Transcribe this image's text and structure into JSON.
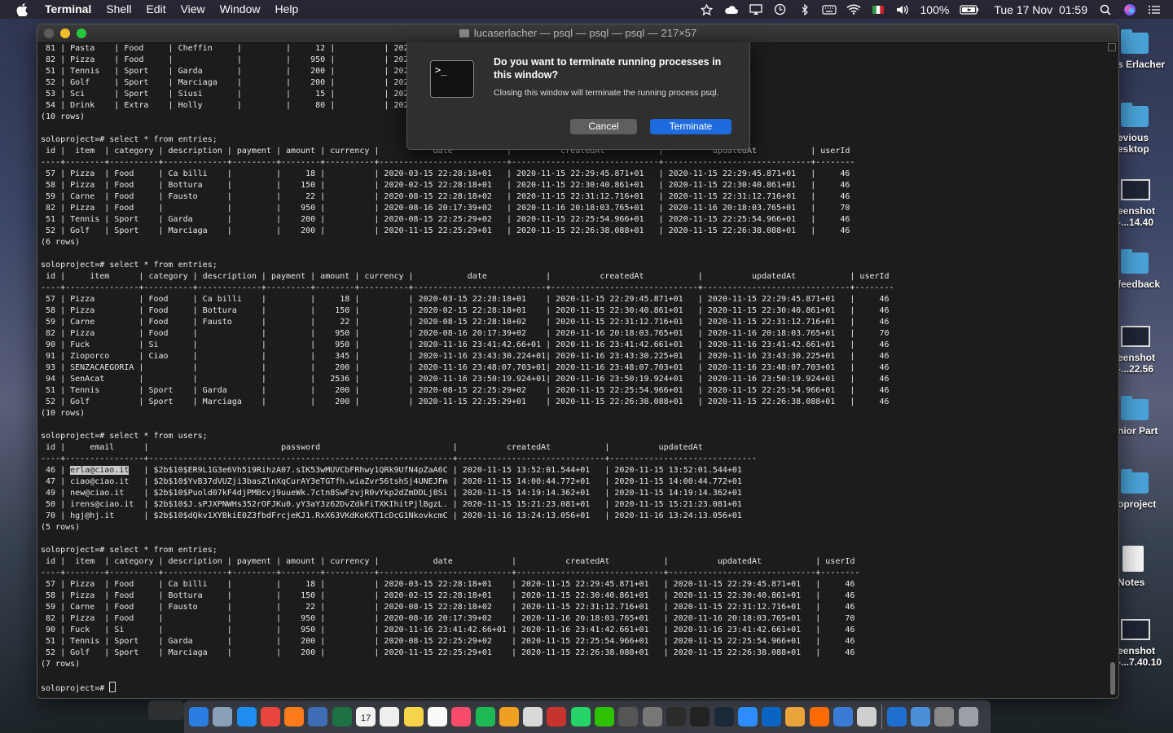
{
  "menubar": {
    "app": "Terminal",
    "items": [
      "Shell",
      "Edit",
      "View",
      "Window",
      "Help"
    ],
    "battery": "100%",
    "datetime": "Tue 17 Nov  01:59"
  },
  "window": {
    "title": "lucaserlacher — psql — psql — psql — 217×57"
  },
  "console_lines": [
    " 81 | Pasta    | Food     | Cheffin     |         |     12 |          | 2020-",
    " 82 | Pizza    | Food     |             |         |    950 |          | 2020-",
    " 51 | Tennis   | Sport    | Garda       |         |    200 |          | 2020-",
    " 52 | Golf     | Sport    | Marciaga    |         |    200 |          | 2020-",
    " 53 | Sci      | Sport    | Siusi       |         |     15 |          | 2020-",
    " 54 | Drink    | Extra    | Holly       |         |     80 |          | 2020-",
    "(10 rows)",
    "",
    "soloproject=# select * from entries;",
    " id |  item  | category | description | payment | amount | currency |           date           |          createdAt           |          updatedAt           | userId",
    "----+--------+----------+-------------+---------+--------+----------+--------------------------+------------------------------+------------------------------+--------",
    " 57 | Pizza  | Food     | Ca billi    |         |     18 |          | 2020-03-15 22:28:18+01   | 2020-11-15 22:29:45.871+01   | 2020-11-15 22:29:45.871+01   |     46",
    " 58 | Pizza  | Food     | Bottura     |         |    150 |          | 2020-02-15 22:28:18+01   | 2020-11-15 22:30:40.861+01   | 2020-11-15 22:30:40.861+01   |     46",
    " 59 | Carne  | Food     | Fausto      |         |     22 |          | 2020-08-15 22:28:18+02   | 2020-11-15 22:31:12.716+01   | 2020-11-15 22:31:12.716+01   |     46",
    " 82 | Pizza  | Food     |             |         |    950 |          | 2020-08-16 20:17:39+02   | 2020-11-16 20:18:03.765+01   | 2020-11-16 20:18:03.765+01   |     70",
    " 51 | Tennis | Sport    | Garda       |         |    200 |          | 2020-08-15 22:25:29+02   | 2020-11-15 22:25:54.966+01   | 2020-11-15 22:25:54.966+01   |     46",
    " 52 | Golf   | Sport    | Marciaga    |         |    200 |          | 2020-11-15 22:25:29+01   | 2020-11-15 22:26:38.088+01   | 2020-11-15 22:26:38.088+01   |     46",
    "(6 rows)",
    "",
    "soloproject=# select * from entries;",
    " id |     item      | category | description | payment | amount | currency |           date            |          createdAt           |          updatedAt           | userId",
    "----+---------------+----------+-------------+---------+--------+----------+---------------------------+------------------------------+------------------------------+--------",
    " 57 | Pizza         | Food     | Ca billi    |         |     18 |          | 2020-03-15 22:28:18+01    | 2020-11-15 22:29:45.871+01   | 2020-11-15 22:29:45.871+01   |     46",
    " 58 | Pizza         | Food     | Bottura     |         |    150 |          | 2020-02-15 22:28:18+01    | 2020-11-15 22:30:40.861+01   | 2020-11-15 22:30:40.861+01   |     46",
    " 59 | Carne         | Food     | Fausto      |         |     22 |          | 2020-08-15 22:28:18+02    | 2020-11-15 22:31:12.716+01   | 2020-11-15 22:31:12.716+01   |     46",
    " 82 | Pizza         | Food     |             |         |    950 |          | 2020-08-16 20:17:39+02    | 2020-11-16 20:18:03.765+01   | 2020-11-16 20:18:03.765+01   |     70",
    " 90 | Fuck          | Si       |             |         |    950 |          | 2020-11-16 23:41:42.66+01 | 2020-11-16 23:41:42.661+01   | 2020-11-16 23:41:42.661+01   |     46",
    " 91 | Zioporco      | Ciao     |             |         |    345 |          | 2020-11-16 23:43:30.224+01| 2020-11-16 23:43:30.225+01   | 2020-11-16 23:43:30.225+01   |     46",
    " 93 | SENZACAEGORIA |          |             |         |    200 |          | 2020-11-16 23:48:07.703+01| 2020-11-16 23:48:07.703+01   | 2020-11-16 23:48:07.703+01   |     46",
    " 94 | SenAcat       |          |             |         |   2536 |          | 2020-11-16 23:50:19.924+01| 2020-11-16 23:50:19.924+01   | 2020-11-16 23:50:19.924+01   |     46",
    " 51 | Tennis        | Sport    | Garda       |         |    200 |          | 2020-08-15 22:25:29+02    | 2020-11-15 22:25:54.966+01   | 2020-11-15 22:25:54.966+01   |     46",
    " 52 | Golf          | Sport    | Marciaga    |         |    200 |          | 2020-11-15 22:25:29+01    | 2020-11-15 22:26:38.088+01   | 2020-11-15 22:26:38.088+01   |     46",
    "(10 rows)",
    "",
    "soloproject=# select * from users;",
    " id |     email      |                           password                           |          createdAt           |          updatedAt",
    "----+----------------+--------------------------------------------------------------+------------------------------+------------------------------",
    " 46 | erla@ciao.it   | $2b$10$ER9L1G3e6Vh519RihzA07.sIK53wMUVCbFRhwy1QRk9UfN4pZaA6C | 2020-11-15 13:52:01.544+01   | 2020-11-15 13:52:01.544+01",
    " 47 | ciao@ciao.it   | $2b$10$YvB37dVUZji3basZlnXqCurAY3eTGTfh.wiaZvr56tshSj4UNEJFm | 2020-11-15 14:00:44.772+01   | 2020-11-15 14:00:44.772+01",
    " 49 | new@ciao.it    | $2b$10$Puold07kF4djPMBcvj9uueWk.7ctn8SwFzvjR0vYkp2dZmDDLj8Si | 2020-11-15 14:19:14.362+01   | 2020-11-15 14:19:14.362+01",
    " 50 | irens@ciao.it  | $2b$10$J.sPJXPNWHs352rOFJKu0.yY3aY3z62DvZdkFiTXKIhitPjlBgzL. | 2020-11-15 15:21:23.081+01   | 2020-11-15 15:21:23.081+01",
    " 70 | hgj@hj.it      | $2b$10$dQkv1XYBkiE0Z3fbdFrcjeKJ1.RxX63VKdKoKXT1cDcG1NkovkcmC | 2020-11-16 13:24:13.056+01   | 2020-11-16 13:24:13.056+01",
    "(5 rows)",
    "",
    "soloproject=# select * from entries;",
    " id |  item  | category | description | payment | amount | currency |           date            |          createdAt           |          updatedAt           | userId",
    "----+--------+----------+-------------+---------+--------+----------+---------------------------+------------------------------+------------------------------+--------",
    " 57 | Pizza  | Food     | Ca billi    |         |     18 |          | 2020-03-15 22:28:18+01    | 2020-11-15 22:29:45.871+01   | 2020-11-15 22:29:45.871+01   |     46",
    " 58 | Pizza  | Food     | Bottura     |         |    150 |          | 2020-02-15 22:28:18+01    | 2020-11-15 22:30:40.861+01   | 2020-11-15 22:30:40.861+01   |     46",
    " 59 | Carne  | Food     | Fausto      |         |     22 |          | 2020-08-15 22:28:18+02    | 2020-11-15 22:31:12.716+01   | 2020-11-15 22:31:12.716+01   |     46",
    " 82 | Pizza  | Food     |             |         |    950 |          | 2020-08-16 20:17:39+02    | 2020-11-16 20:18:03.765+01   | 2020-11-16 20:18:03.765+01   |     70",
    " 90 | Fuck   | Si       |             |         |    950 |          | 2020-11-16 23:41:42.66+01 | 2020-11-16 23:41:42.661+01   | 2020-11-16 23:41:42.661+01   |     46",
    " 51 | Tennis | Sport    | Garda       |         |    200 |          | 2020-08-15 22:25:29+02    | 2020-11-15 22:25:54.966+01   | 2020-11-15 22:25:54.966+01   |     46",
    " 52 | Golf   | Sport    | Marciaga    |         |    200 |          | 2020-11-15 22:25:29+01    | 2020-11-15 22:26:38.088+01   | 2020-11-15 22:26:38.088+01   |     46",
    "(7 rows)",
    ""
  ],
  "prompt": "soloproject=# ",
  "highlight_text": "erla@ciao.it",
  "dialog": {
    "icon_text": ">_",
    "title": "Do you want to terminate running processes in this window?",
    "message": "Closing this window will terminate the running process psql.",
    "cancel": "Cancel",
    "terminate": "Terminate"
  },
  "desktop_items": [
    {
      "label": "s Erlacher",
      "icon": "folder-icon"
    },
    {
      "label": "evious\nesktop",
      "icon": "folder-icon"
    },
    {
      "label": "eenshot\n-...14.40",
      "icon": "screenshot-icon"
    },
    {
      "label": "feedback",
      "icon": "folder-icon"
    },
    {
      "label": "eenshot\n-...22.56",
      "icon": "screenshot-icon"
    },
    {
      "label": "nior Part",
      "icon": "folder-icon"
    },
    {
      "label": "oproject",
      "icon": "folder-icon"
    },
    {
      "label": "Notes",
      "icon": "document-icon"
    },
    {
      "label": "eenshot\n-...7.40.10",
      "icon": "screenshot-icon"
    }
  ],
  "dock": {
    "calendar_day": "17",
    "app_colors": [
      "#2a7de1",
      "#8aa0b8",
      "#1f8cf0",
      "#e8453c",
      "#ff7a1a",
      "#3e6db5",
      "#1e7145",
      "#f2f2f2",
      "#eeeeee",
      "#f6d44a",
      "#fafafa",
      "#fb4b6a",
      "#1db954",
      "#f0a020",
      "#d9d9d9",
      "#c8342d",
      "#25d366",
      "#2dc100",
      "#555555",
      "#777777",
      "#2b2b2b",
      "#222222",
      "#1b2838",
      "#2d8cff",
      "#0a64c2",
      "#e8a33a",
      "#ff6a00",
      "#3a7bd5",
      "#cfcfcf",
      "#1e6fd0",
      "#4a90d9",
      "#888888",
      "#9aa0a6"
    ]
  }
}
